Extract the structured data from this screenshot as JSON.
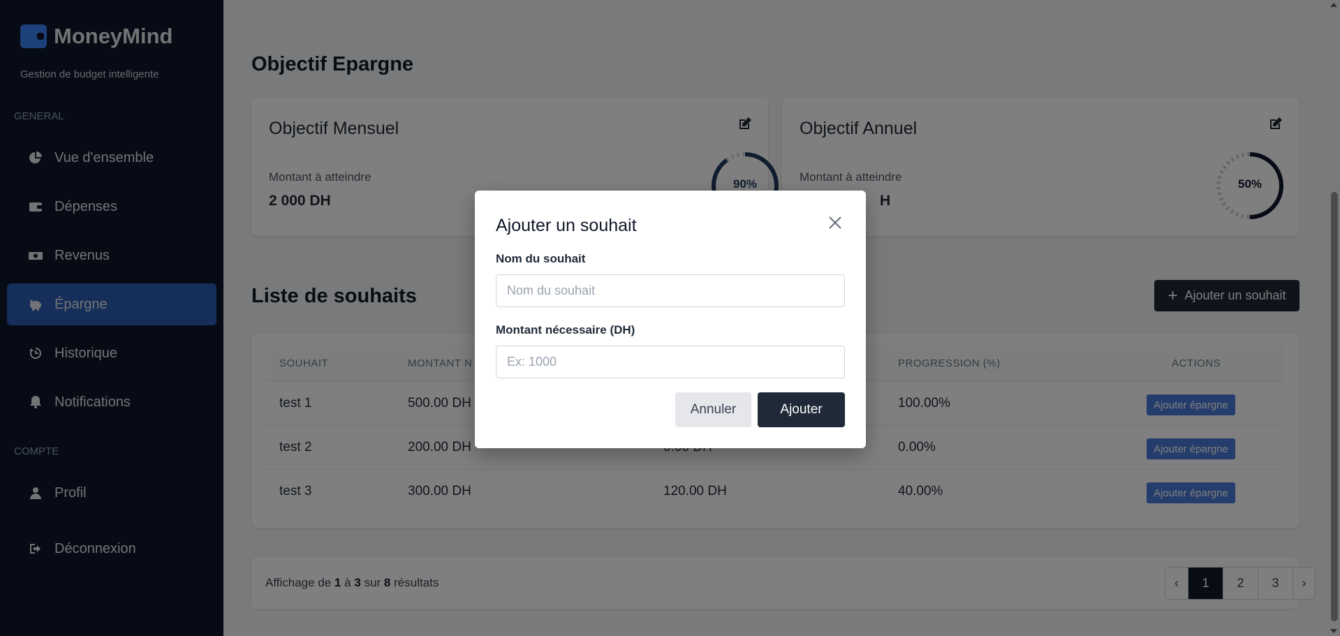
{
  "brand": {
    "name": "MoneyMind",
    "tagline": "Gestion de budget intelligente"
  },
  "sidebar": {
    "general_label": "GENERAL",
    "compte_label": "COMPTE",
    "items": [
      {
        "label": "Vue d'ensemble",
        "icon": "pie-chart-icon"
      },
      {
        "label": "Dépenses",
        "icon": "wallet-icon"
      },
      {
        "label": "Revenus",
        "icon": "money-bill-icon"
      },
      {
        "label": "Épargne",
        "icon": "piggy-bank-icon",
        "active": true
      },
      {
        "label": "Historique",
        "icon": "history-icon"
      },
      {
        "label": "Notifications",
        "icon": "bell-icon"
      }
    ],
    "account_items": [
      {
        "label": "Profil",
        "icon": "user-icon"
      },
      {
        "label": "Déconnexion",
        "icon": "logout-icon"
      }
    ]
  },
  "savings": {
    "title": "Objectif Epargne",
    "monthly": {
      "title": "Objectif Mensuel",
      "sub": "Montant à atteindre",
      "amount": "2 000 DH",
      "percent_label": "90%",
      "progress": 0.9,
      "color": "#1e3a5f"
    },
    "annual": {
      "title": "Objectif Annuel",
      "sub": "Montant à atteindre",
      "amount": "H",
      "percent_label": "50%",
      "progress": 0.5,
      "color": "#0f172a"
    }
  },
  "wishlist": {
    "title": "Liste de souhaits",
    "add_button": "Ajouter un souhait",
    "columns": [
      "SOUHAIT",
      "MONTANT N",
      "PROGRESSION (%)",
      "ACTIONS"
    ],
    "rows": [
      {
        "name": "test 1",
        "amount": "500.00 DH",
        "saved": "",
        "progress": "100.00%",
        "action": "Ajouter épargne"
      },
      {
        "name": "test 2",
        "amount": "200.00 DH",
        "saved": "0.00 DH",
        "progress": "0.00%",
        "action": "Ajouter épargne"
      },
      {
        "name": "test 3",
        "amount": "300.00 DH",
        "saved": "120.00 DH",
        "progress": "40.00%",
        "action": "Ajouter épargne"
      }
    ]
  },
  "pagination": {
    "prefix": "Affichage de",
    "from": "1",
    "to_word": "à",
    "to": "3",
    "of_word": "sur",
    "total": "8",
    "suffix": "résultats",
    "pages": [
      "1",
      "2",
      "3"
    ],
    "active_page": "1"
  },
  "modal": {
    "title": "Ajouter un souhait",
    "name_label": "Nom du souhait",
    "name_placeholder": "Nom du souhait",
    "amount_label": "Montant nécessaire (DH)",
    "amount_placeholder": "Ex: 1000",
    "cancel": "Annuler",
    "submit": "Ajouter"
  }
}
